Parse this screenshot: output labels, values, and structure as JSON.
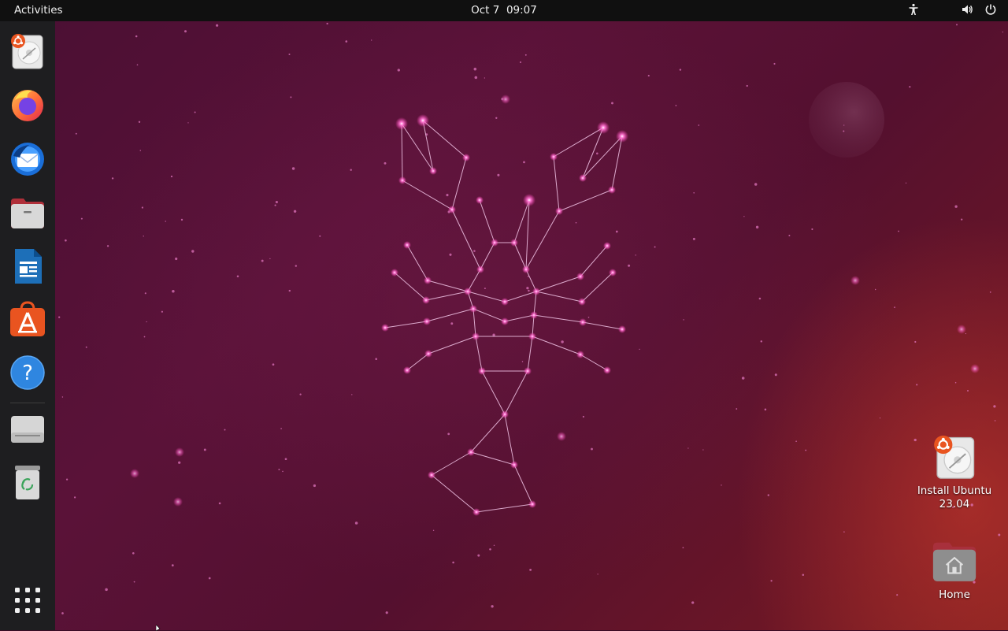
{
  "topbar": {
    "activities_label": "Activities",
    "date": "Oct 7",
    "time": "09:07"
  },
  "tray_icons": [
    "accessibility-icon",
    "volume-icon",
    "power-icon"
  ],
  "dock": {
    "items": [
      {
        "name": "install-ubuntu",
        "icon": "ubuntu-installer-icon"
      },
      {
        "name": "firefox",
        "icon": "firefox-icon"
      },
      {
        "name": "thunderbird",
        "icon": "thunderbird-icon"
      },
      {
        "name": "files",
        "icon": "files-icon"
      },
      {
        "name": "libreoffice-writer",
        "icon": "writer-icon"
      },
      {
        "name": "app-center",
        "icon": "app-center-icon"
      },
      {
        "name": "help",
        "icon": "help-icon"
      },
      {
        "name": "drive",
        "icon": "drive-icon"
      },
      {
        "name": "trash",
        "icon": "trash-icon"
      }
    ],
    "show_apps_icon": "apps-grid-icon"
  },
  "desktop": {
    "icons": [
      {
        "label_line1": "Install Ubuntu",
        "label_line2": "23.04",
        "icon": "ubuntu-installer-icon"
      },
      {
        "label_line1": "Home",
        "icon": "home-folder-icon"
      }
    ]
  },
  "colors": {
    "topbar_bg": "#101010",
    "dock_bg": "#1e1e20",
    "ubuntu_orange": "#e95420",
    "wallpaper_base": "#4a0f33",
    "constellation_star": "#ff5ec8"
  }
}
